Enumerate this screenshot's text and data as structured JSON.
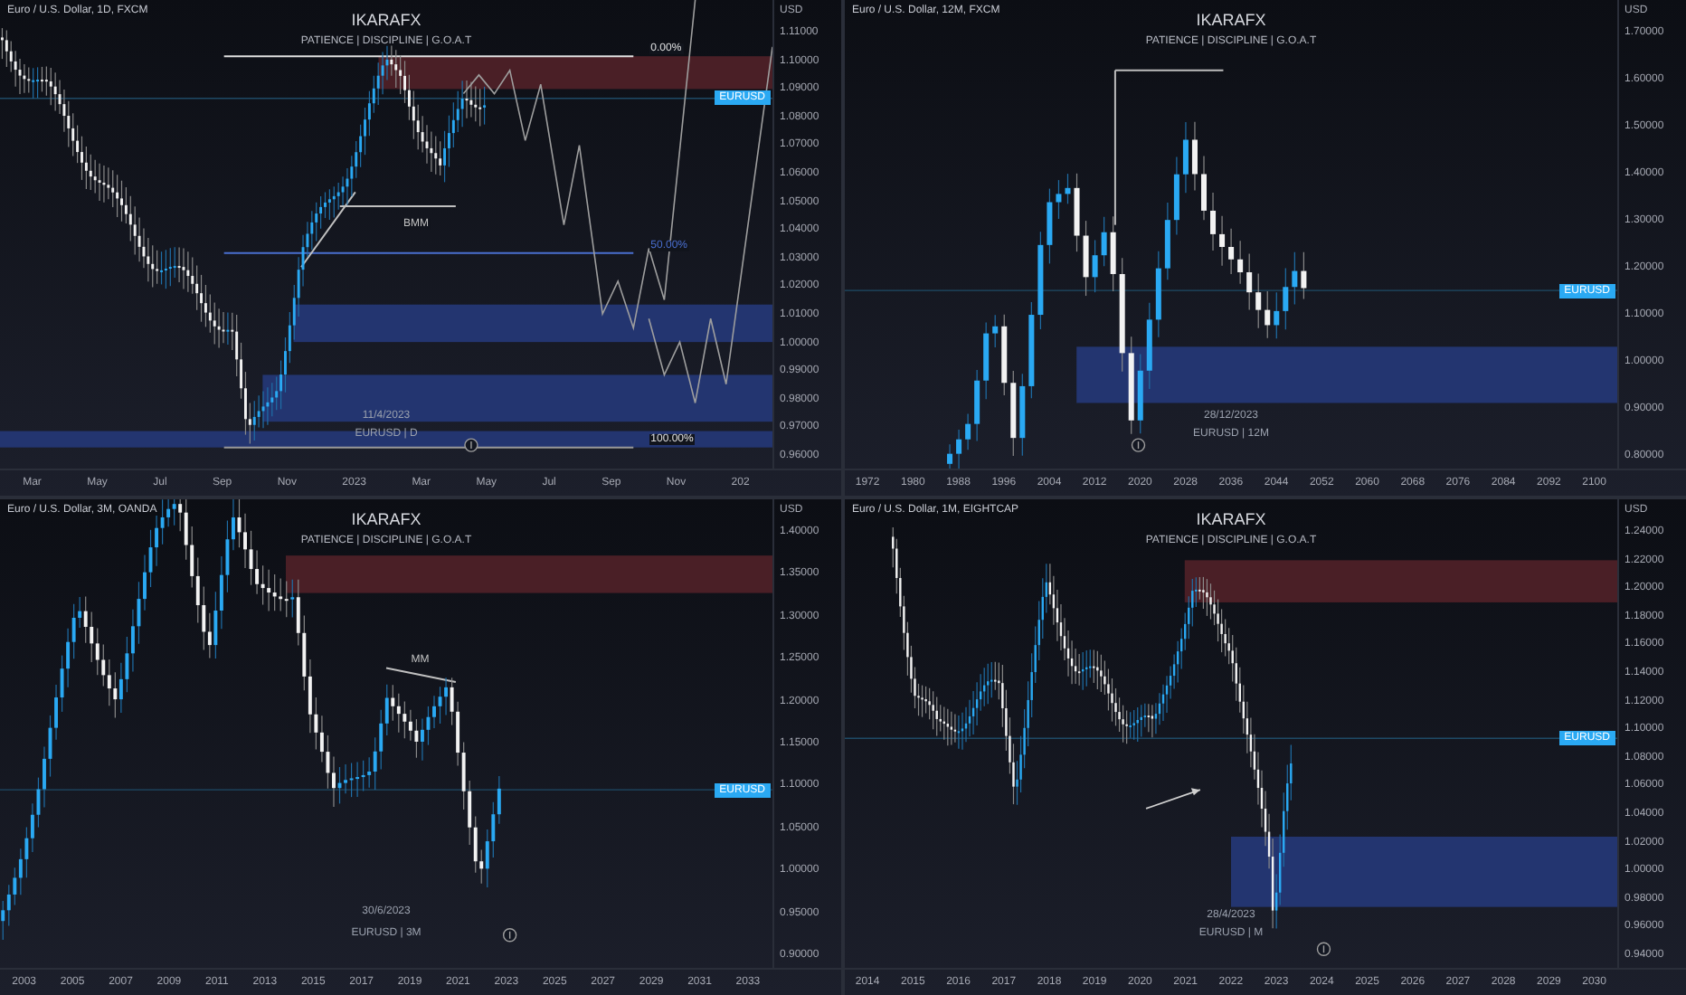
{
  "panels": [
    {
      "symbol": "Euro / U.S. Dollar, 1D, FXCM",
      "title": "IKARAFX",
      "subtitle": "PATIENCE | DISCIPLINE | G.O.A.T",
      "axis_unit": "USD",
      "price_axis": [
        "1.11000",
        "1.10000",
        "1.09000",
        "1.08000",
        "1.07000",
        "1.06000",
        "1.05000",
        "1.04000",
        "1.03000",
        "1.02000",
        "1.01000",
        "1.00000",
        "0.99000",
        "0.98000",
        "0.97000",
        "0.96000"
      ],
      "time_axis": [
        "Mar",
        "May",
        "Jul",
        "Sep",
        "Nov",
        "2023",
        "Mar",
        "May",
        "Jul",
        "Sep",
        "Nov",
        "202"
      ],
      "price_tag": "EURUSD",
      "annotations": [
        "0.00%",
        "BMM",
        "50.00%",
        "100.00%"
      ],
      "date": "11/4/2023",
      "watermark": "EURUSD | D"
    },
    {
      "symbol": "Euro / U.S. Dollar, 12M, FXCM",
      "title": "IKARAFX",
      "subtitle": "PATIENCE | DISCIPLINE | G.O.A.T",
      "axis_unit": "USD",
      "price_axis": [
        "1.70000",
        "1.60000",
        "1.50000",
        "1.40000",
        "1.30000",
        "1.20000",
        "1.10000",
        "1.00000",
        "0.90000",
        "0.80000"
      ],
      "time_axis": [
        "1972",
        "1980",
        "1988",
        "1996",
        "2004",
        "2012",
        "2020",
        "2028",
        "2036",
        "2044",
        "2052",
        "2060",
        "2068",
        "2076",
        "2084",
        "2092",
        "2100"
      ],
      "price_tag": "EURUSD",
      "date": "28/12/2023",
      "watermark": "EURUSD | 12M"
    },
    {
      "symbol": "Euro / U.S. Dollar, 3M, OANDA",
      "title": "IKARAFX",
      "subtitle": "PATIENCE | DISCIPLINE | G.O.A.T",
      "axis_unit": "USD",
      "price_axis": [
        "1.40000",
        "1.35000",
        "1.30000",
        "1.25000",
        "1.20000",
        "1.15000",
        "1.10000",
        "1.05000",
        "1.00000",
        "0.95000",
        "0.90000"
      ],
      "time_axis": [
        "2003",
        "2005",
        "2007",
        "2009",
        "2011",
        "2013",
        "2015",
        "2017",
        "2019",
        "2021",
        "2023",
        "2025",
        "2027",
        "2029",
        "2031",
        "2033"
      ],
      "price_tag": "EURUSD",
      "annotations": [
        "MM"
      ],
      "date": "30/6/2023",
      "watermark": "EURUSD | 3M"
    },
    {
      "symbol": "Euro / U.S. Dollar, 1M, EIGHTCAP",
      "title": "IKARAFX",
      "subtitle": "PATIENCE | DISCIPLINE | G.O.A.T",
      "axis_unit": "USD",
      "price_axis": [
        "1.24000",
        "1.22000",
        "1.20000",
        "1.18000",
        "1.16000",
        "1.14000",
        "1.12000",
        "1.10000",
        "1.08000",
        "1.06000",
        "1.04000",
        "1.02000",
        "1.00000",
        "0.98000",
        "0.96000",
        "0.94000"
      ],
      "time_axis": [
        "2014",
        "2015",
        "2016",
        "2017",
        "2018",
        "2019",
        "2020",
        "2021",
        "2022",
        "2023",
        "2024",
        "2025",
        "2026",
        "2027",
        "2028",
        "2029",
        "2030"
      ],
      "price_tag": "EURUSD",
      "date": "28/4/2023",
      "watermark": "EURUSD | M"
    }
  ]
}
